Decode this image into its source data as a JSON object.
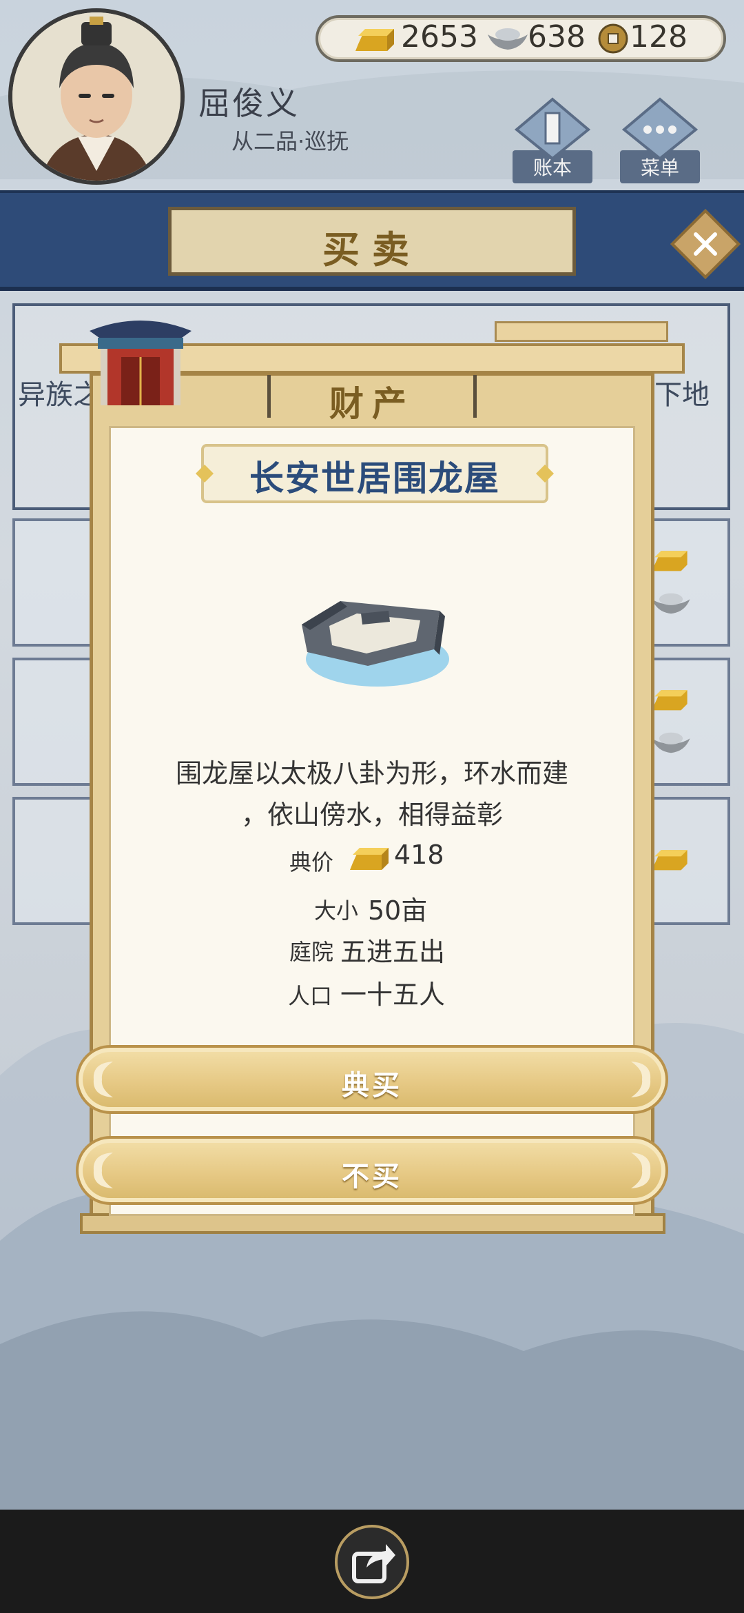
{
  "player": {
    "name": "屈俊义",
    "rank": "从二品·巡抚"
  },
  "currency": {
    "gold": "2653",
    "silver": "638",
    "copper": "128"
  },
  "header_menu": {
    "ledger": "账本",
    "menu": "菜单"
  },
  "page_title": "买卖",
  "background": {
    "left_tab_text": "异族之",
    "right_tab_text": "买下地"
  },
  "dialog": {
    "header": "财产",
    "item_name": "长安世居围龙屋",
    "description_line1": "围龙屋以太极八卦为形，环水而建",
    "description_line2": "，依山傍水，相得益彰",
    "stats": [
      {
        "label": "典价",
        "value": "418",
        "icon": "gold-ingot-icon"
      },
      {
        "label": "大小",
        "value": "50亩"
      },
      {
        "label": "庭院",
        "value": "五进五出"
      },
      {
        "label": "人口",
        "value": "一十五人"
      }
    ],
    "buy_button": "典买",
    "cancel_button": "不买"
  },
  "colors": {
    "banner_blue": "#2e4b78",
    "title_blue": "#2b4c7b",
    "gold_frame": "#e5cf99",
    "parchment": "#fbf8ef"
  }
}
